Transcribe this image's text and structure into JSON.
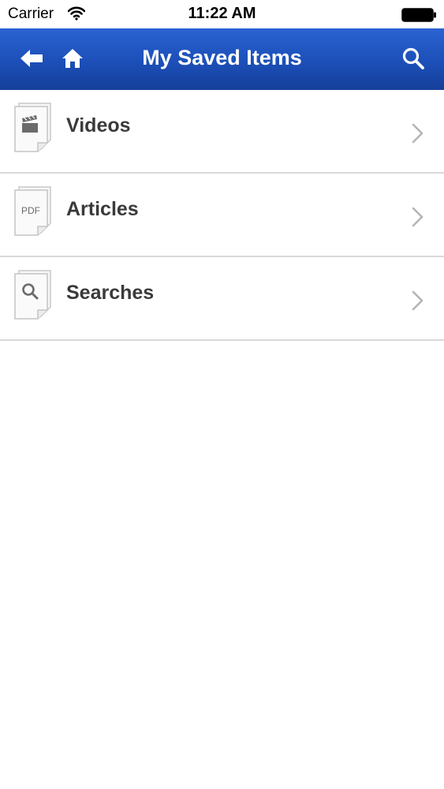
{
  "status_bar": {
    "carrier": "Carrier",
    "time": "11:22 AM",
    "wifi_icon": "wifi-icon",
    "battery_icon": "battery-icon"
  },
  "nav_bar": {
    "title": "My Saved Items",
    "background_color": "#1c4fb8",
    "back_icon": "back-arrow-icon",
    "home_icon": "home-icon",
    "search_icon": "search-icon"
  },
  "items": [
    {
      "label": "Videos",
      "icon": "video-document-icon"
    },
    {
      "label": "Articles",
      "icon": "pdf-document-icon",
      "icon_text": "PDF"
    },
    {
      "label": "Searches",
      "icon": "search-document-icon"
    }
  ],
  "colors": {
    "label": "#3a3a3a",
    "separator": "#d9d9d9",
    "chevron": "#b5b5b5"
  }
}
